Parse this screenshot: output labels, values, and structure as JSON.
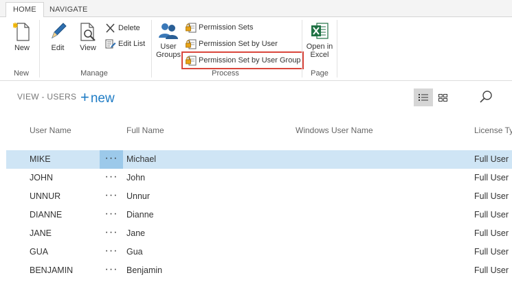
{
  "tabs": {
    "home": "HOME",
    "navigate": "NAVIGATE"
  },
  "ribbon": {
    "new_group": {
      "new_label": "New",
      "group_label": "New"
    },
    "manage_group": {
      "edit_label": "Edit",
      "view_label": "View",
      "delete_label": "Delete",
      "edit_list_label": "Edit List",
      "group_label": "Manage"
    },
    "process_group": {
      "user_groups_label_1": "User",
      "user_groups_label_2": "Groups",
      "permission_sets_label": "Permission Sets",
      "permission_set_by_user_label": "Permission Set by User",
      "permission_set_by_user_group_label": "Permission Set by User Group",
      "group_label": "Process"
    },
    "page_group": {
      "open_in_excel_label_1": "Open in",
      "open_in_excel_label_2": "Excel",
      "group_label": "Page"
    }
  },
  "view": {
    "title": "VIEW - USERS",
    "new_plus": "+",
    "new_label": "new"
  },
  "table": {
    "columns": {
      "user_name": "User Name",
      "full_name": "Full Name",
      "windows_user_name": "Windows User Name",
      "license_type": "License Typ"
    },
    "dots": "···",
    "rows": [
      {
        "user_name": "MIKE",
        "full_name": "Michael",
        "windows_user_name": "",
        "license_type": "Full User"
      },
      {
        "user_name": "JOHN",
        "full_name": "John",
        "windows_user_name": "",
        "license_type": "Full User"
      },
      {
        "user_name": "UNNUR",
        "full_name": "Unnur",
        "windows_user_name": "",
        "license_type": "Full User"
      },
      {
        "user_name": "DIANNE",
        "full_name": "Dianne",
        "windows_user_name": "",
        "license_type": "Full User"
      },
      {
        "user_name": "JANE",
        "full_name": "Jane",
        "windows_user_name": "",
        "license_type": "Full User"
      },
      {
        "user_name": "GUA",
        "full_name": "Gua",
        "windows_user_name": "",
        "license_type": "Full User"
      },
      {
        "user_name": "BENJAMIN",
        "full_name": "Benjamin",
        "windows_user_name": "",
        "license_type": "Full User"
      }
    ]
  },
  "colors": {
    "accent_blue": "#1f7cc5",
    "selected_row": "#cfe5f5",
    "selected_dots": "#9cc9ea",
    "highlight_red": "#d9453b",
    "excel_green": "#1f7244"
  },
  "icons": {
    "new": "new-document-icon",
    "edit": "pencil-icon",
    "view": "magnifier-document-icon",
    "delete": "x-icon",
    "edit_list": "edit-list-icon",
    "user_groups": "users-icon",
    "permission": "lock-document-icon",
    "excel": "excel-icon",
    "list_view": "list-view-icon",
    "tile_view": "tile-view-icon",
    "search": "search-icon"
  }
}
